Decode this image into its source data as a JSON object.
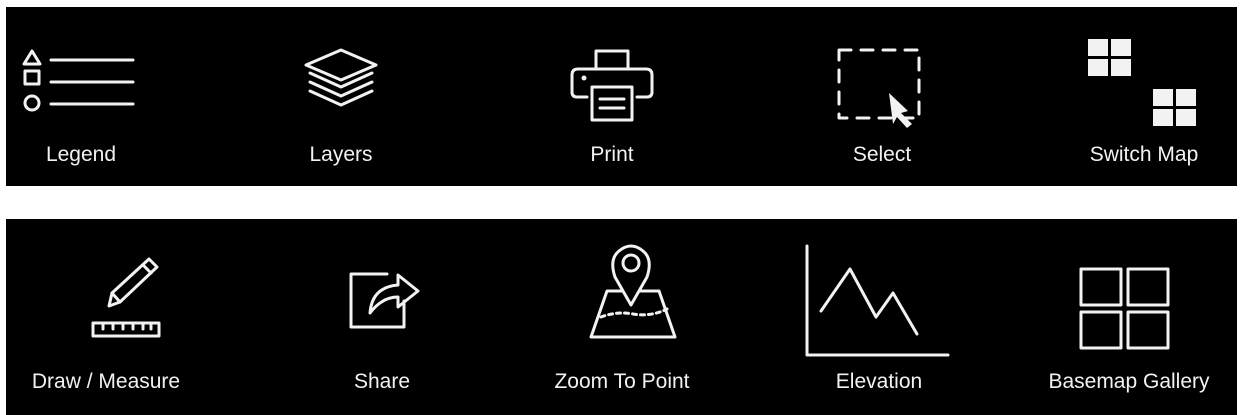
{
  "toolbar_top": {
    "tools": [
      {
        "label": "Legend",
        "icon": "legend-icon"
      },
      {
        "label": "Layers",
        "icon": "layers-icon"
      },
      {
        "label": "Print",
        "icon": "printer-icon"
      },
      {
        "label": "Select",
        "icon": "select-icon"
      },
      {
        "label": "Switch Map",
        "icon": "switch-map-icon"
      }
    ]
  },
  "toolbar_bottom": {
    "tools": [
      {
        "label": "Draw / Measure",
        "icon": "pencil-ruler-icon"
      },
      {
        "label": "Share",
        "icon": "share-icon"
      },
      {
        "label": "Zoom To Point",
        "icon": "map-pin-icon"
      },
      {
        "label": "Elevation",
        "icon": "elevation-chart-icon"
      },
      {
        "label": "Basemap Gallery",
        "icon": "basemap-gallery-icon"
      }
    ]
  },
  "colors": {
    "background": "#000000",
    "foreground": "#f2f2f2",
    "page": "#ffffff"
  }
}
